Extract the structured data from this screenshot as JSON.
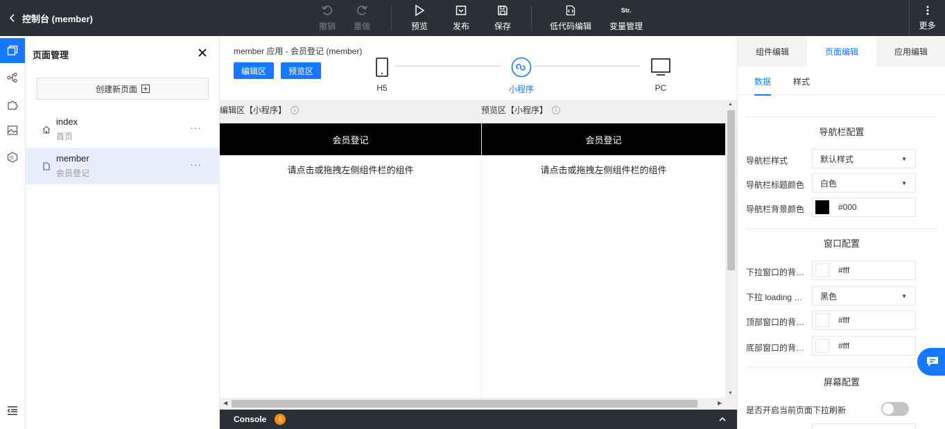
{
  "topbar": {
    "back_label": "控制台 (member)",
    "undo": "撤销",
    "redo": "重做",
    "preview": "预览",
    "publish": "发布",
    "save": "保存",
    "lowcode_icon": "</>",
    "lowcode": "低代码编辑",
    "vars_icon": "Str.",
    "vars": "变量管理",
    "more": "更多"
  },
  "page_manager": {
    "title": "页面管理",
    "create": "创建新页面",
    "pages": [
      {
        "name": "index",
        "title": "首页",
        "active": false
      },
      {
        "name": "member",
        "title": "会员登记",
        "active": true
      }
    ],
    "more_glyph": "···"
  },
  "center": {
    "breadcrumb": "member 应用 - 会员登记 (member)",
    "edit_btn": "编辑区",
    "preview_btn": "预览区",
    "devices": [
      {
        "label": "H5",
        "icon": "phone-icon",
        "active": false
      },
      {
        "label": "小程序",
        "icon": "miniprogram-icon",
        "active": true
      },
      {
        "label": "PC",
        "icon": "monitor-icon",
        "active": false
      }
    ],
    "edit_zone_title": "编辑区【小程序】",
    "preview_zone_title": "预览区【小程序】",
    "info_glyph": "i",
    "page_nav_title": "会员登记",
    "empty_hint": "请点击或拖拽左侧组件栏的组件",
    "console_label": "Console",
    "console_count": "6"
  },
  "right_panel": {
    "tabs": [
      {
        "label": "组件编辑",
        "active": false
      },
      {
        "label": "页面编辑",
        "active": true
      },
      {
        "label": "应用编辑",
        "active": false
      }
    ],
    "subtabs": [
      {
        "label": "数据",
        "active": true
      },
      {
        "label": "样式",
        "active": false
      }
    ],
    "nav_section": "导航栏配置",
    "nav_style_label": "导航栏样式",
    "nav_style_value": "默认样式",
    "nav_title_color_label": "导航栏标题颜色",
    "nav_title_color_value": "白色",
    "nav_bg_color_label": "导航栏背景颜色",
    "nav_bg_color_value": "#000",
    "window_section": "窗口配置",
    "pulldown_bg_label": "下拉窗口的背景色",
    "pulldown_bg_value": "#fff",
    "pulldown_loading_label": "下拉 loading 的样式",
    "pulldown_loading_value": "黑色",
    "top_window_bg_label": "顶部窗口的背景色",
    "top_window_bg_value": "#fff",
    "bottom_window_bg_label": "底部窗口的背景色",
    "bottom_window_bg_value": "#fff",
    "screen_section": "屏幕配置",
    "pull_refresh_label": "是否开启当前页面下拉刷新",
    "pull_refresh_on": false
  },
  "colors": {
    "accent": "#1677ff",
    "topbar_bg": "#2b2f36",
    "badge": "#fa8c16",
    "nav_bg": "#000000"
  }
}
